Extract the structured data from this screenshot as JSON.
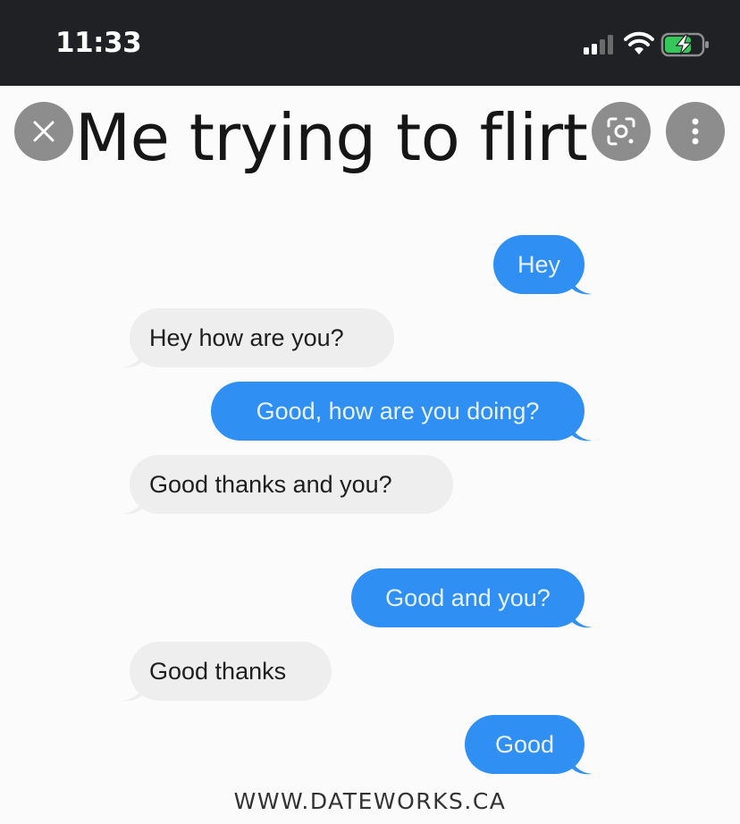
{
  "status_bar": {
    "time": "11:33",
    "signal_icon": "cellular-signal-icon",
    "wifi_icon": "wifi-icon",
    "battery_icon": "battery-charging-icon",
    "battery_color": "#35c759"
  },
  "overlay": {
    "close_icon": "close-icon",
    "lens_icon": "lens-search-icon",
    "more_icon": "more-vertical-icon"
  },
  "meme": {
    "title": "Me trying to flirt",
    "messages": [
      {
        "side": "sent",
        "text": "Hey"
      },
      {
        "side": "received",
        "text": "Hey how are you?"
      },
      {
        "side": "sent",
        "text": "Good, how are you doing?"
      },
      {
        "side": "received",
        "text": "Good thanks and you?"
      },
      {
        "side": "sent",
        "text": "Good and you?"
      },
      {
        "side": "received",
        "text": "Good thanks"
      },
      {
        "side": "sent",
        "text": "Good"
      }
    ],
    "watermark": "WWW.DATEWORKS.CA",
    "colors": {
      "sent_bubble": "#2f8ff2",
      "received_bubble": "#eeeeee"
    }
  }
}
